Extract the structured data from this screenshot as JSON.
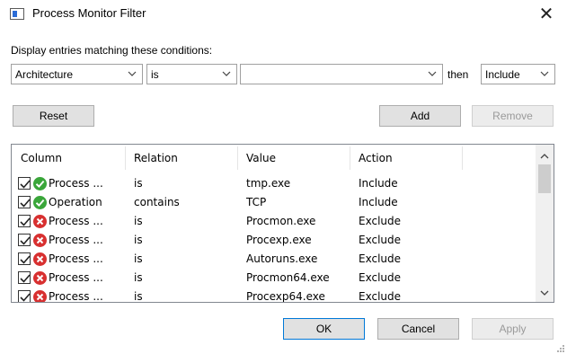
{
  "window": {
    "title": "Process Monitor Filter",
    "close_glyph": "✕"
  },
  "conditions": {
    "label": "Display entries matching these conditions:",
    "column_select": "Architecture",
    "relation_select": "is",
    "value_input": "",
    "then_label": "then",
    "action_select": "Include"
  },
  "buttons": {
    "reset": "Reset",
    "add": "Add",
    "remove": "Remove",
    "ok": "OK",
    "cancel": "Cancel",
    "apply": "Apply"
  },
  "list": {
    "columns": [
      "Column",
      "Relation",
      "Value",
      "Action"
    ],
    "rows": [
      {
        "checked": true,
        "status": "include",
        "column": "Process ...",
        "relation": "is",
        "value": "tmp.exe",
        "action": "Include"
      },
      {
        "checked": true,
        "status": "include",
        "column": "Operation",
        "relation": "contains",
        "value": "TCP",
        "action": "Include"
      },
      {
        "checked": true,
        "status": "exclude",
        "column": "Process ...",
        "relation": "is",
        "value": "Procmon.exe",
        "action": "Exclude"
      },
      {
        "checked": true,
        "status": "exclude",
        "column": "Process ...",
        "relation": "is",
        "value": "Procexp.exe",
        "action": "Exclude"
      },
      {
        "checked": true,
        "status": "exclude",
        "column": "Process ...",
        "relation": "is",
        "value": "Autoruns.exe",
        "action": "Exclude"
      },
      {
        "checked": true,
        "status": "exclude",
        "column": "Process ...",
        "relation": "is",
        "value": "Procmon64.exe",
        "action": "Exclude"
      },
      {
        "checked": true,
        "status": "exclude",
        "column": "Process ...",
        "relation": "is",
        "value": "Procexp64.exe",
        "action": "Exclude"
      }
    ]
  },
  "colors": {
    "include_icon": "#3aa63a",
    "exclude_icon": "#d83030",
    "focus_border": "#0078d7"
  },
  "icons": {
    "include": "green-check-circle-icon",
    "exclude": "red-x-circle-icon"
  }
}
